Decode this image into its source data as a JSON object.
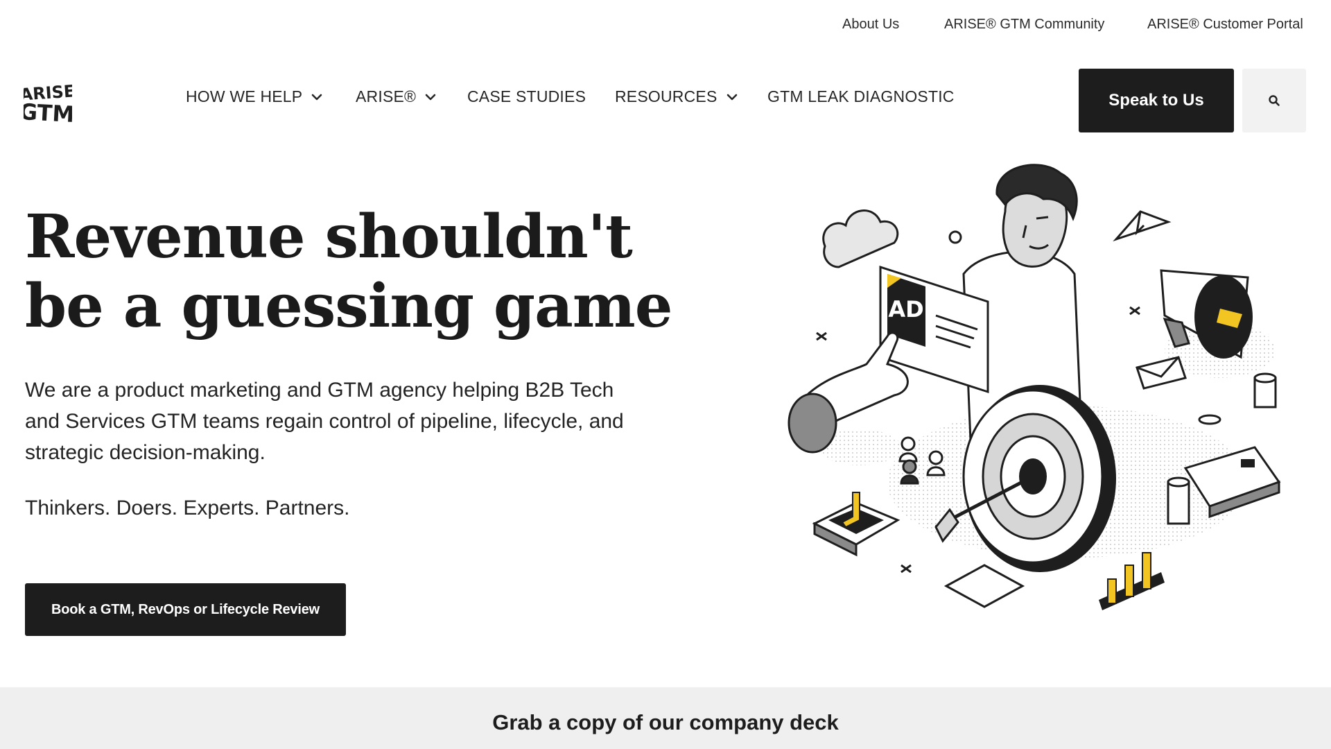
{
  "utility_nav": {
    "about": "About Us",
    "community": "ARISE® GTM Community",
    "portal": "ARISE® Customer Portal"
  },
  "logo": {
    "line1": "ARISE",
    "line2": "GTM"
  },
  "main_nav": {
    "how_we_help": "HOW WE HELP",
    "arise": "ARISE®",
    "case_studies": "CASE STUDIES",
    "resources": "RESOURCES",
    "leak_diagnostic": "GTM LEAK DIAGNOSTIC"
  },
  "header": {
    "speak_label": "Speak to Us",
    "search_icon": "search-icon"
  },
  "hero": {
    "title_line1": "Revenue shouldn't",
    "title_line2": "be a guessing game",
    "description": "We are a product marketing and GTM agency helping B2B Tech and Services GTM teams regain control of pipeline, lifecycle, and strategic decision-making.",
    "tagline": "Thinkers. Doers. Experts. Partners.",
    "cta_label": "Book a GTM, RevOps or Lifecycle Review",
    "ad_label": "AD"
  },
  "deck": {
    "title": "Grab a copy of our company deck"
  },
  "colors": {
    "dark": "#1d1d1d",
    "accent_yellow": "#f2c522",
    "band_gray": "#efefef",
    "search_bg": "#f2f2f2"
  }
}
